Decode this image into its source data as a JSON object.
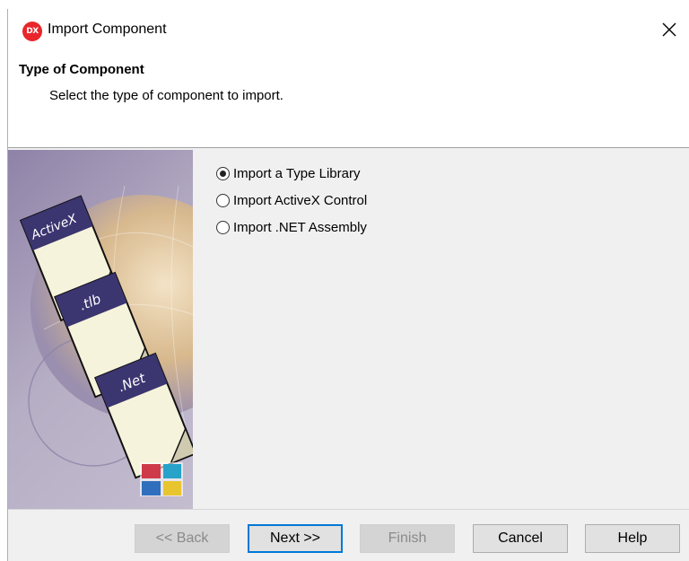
{
  "window": {
    "title": "Import Component",
    "app_icon": "DX",
    "close_icon": "close-icon"
  },
  "header": {
    "title": "Type of Component",
    "subtitle": "Select the type of component to import."
  },
  "illustration": {
    "labels": [
      "ActiveX",
      ".tlb",
      ".Net"
    ]
  },
  "options": [
    {
      "label": "Import a Type Library",
      "checked": true
    },
    {
      "label": "Import ActiveX Control",
      "checked": false
    },
    {
      "label": "Import .NET Assembly",
      "checked": false
    }
  ],
  "buttons": {
    "back": "<< Back",
    "next": "Next >>",
    "finish": "Finish",
    "cancel": "Cancel",
    "help": "Help"
  },
  "colors": {
    "accent": "#0078d7",
    "app_icon": "#e8262b"
  }
}
